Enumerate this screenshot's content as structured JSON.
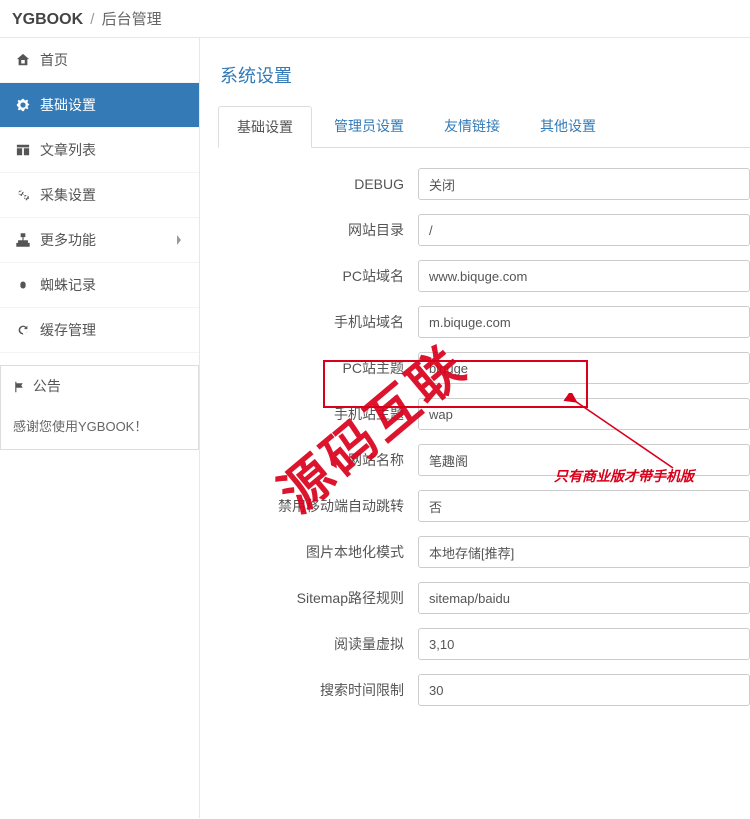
{
  "header": {
    "brand": "YGBOOK",
    "sep": "/",
    "crumb": "后台管理"
  },
  "sidebar": {
    "items": [
      {
        "label": "首页"
      },
      {
        "label": "基础设置"
      },
      {
        "label": "文章列表"
      },
      {
        "label": "采集设置"
      },
      {
        "label": "更多功能"
      },
      {
        "label": "蜘蛛记录"
      },
      {
        "label": "缓存管理"
      }
    ]
  },
  "notice": {
    "title": "公告",
    "body": "感谢您使用YGBOOK！"
  },
  "page": {
    "title": "系统设置"
  },
  "tabs": [
    {
      "label": "基础设置"
    },
    {
      "label": "管理员设置"
    },
    {
      "label": "友情链接"
    },
    {
      "label": "其他设置"
    }
  ],
  "form": {
    "debug": {
      "label": "DEBUG",
      "value": "关闭"
    },
    "webroot": {
      "label": "网站目录",
      "value": "/"
    },
    "pc_domain": {
      "label": "PC站域名",
      "value": "www.biquge.com"
    },
    "m_domain": {
      "label": "手机站域名",
      "value": "m.biquge.com"
    },
    "pc_theme": {
      "label": "PC站主题",
      "value": "biquge"
    },
    "m_theme": {
      "label": "手机站主题",
      "value": "wap"
    },
    "site_name": {
      "label": "网站名称",
      "value": "笔趣阁"
    },
    "no_mjump": {
      "label": "禁用移动端自动跳转",
      "value": "否"
    },
    "img_mode": {
      "label": "图片本地化模式",
      "value": "本地存储[推荐]"
    },
    "sitemap": {
      "label": "Sitemap路径规则",
      "value": "sitemap/baidu"
    },
    "read_fake": {
      "label": "阅读量虚拟",
      "value": "3,10"
    },
    "search_limit": {
      "label": "搜索时间限制",
      "value": "30"
    }
  },
  "annotations": {
    "watermark": "源码互联",
    "callout": "只有商业版才带手机版"
  }
}
